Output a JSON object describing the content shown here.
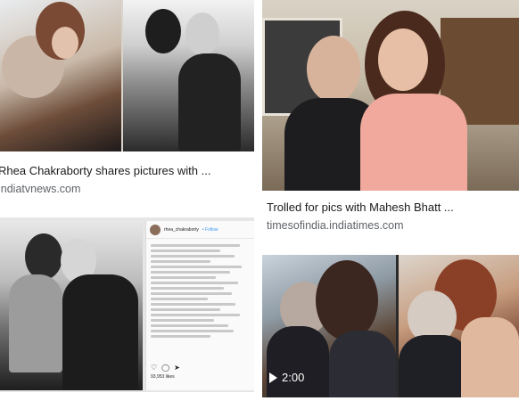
{
  "results": [
    {
      "title": "Rhea Chakraborty shares pictures with ...",
      "source": "indiatvnews.com"
    },
    {
      "title": "Trolled for pics with Mahesh Bhatt ...",
      "source": "timesofindia.indiatimes.com"
    },
    {
      "instagram": {
        "username": "rhea_chakraborty",
        "follow": "• Follow",
        "likes": "93,953 likes"
      }
    },
    {
      "duration": "2:00"
    }
  ]
}
